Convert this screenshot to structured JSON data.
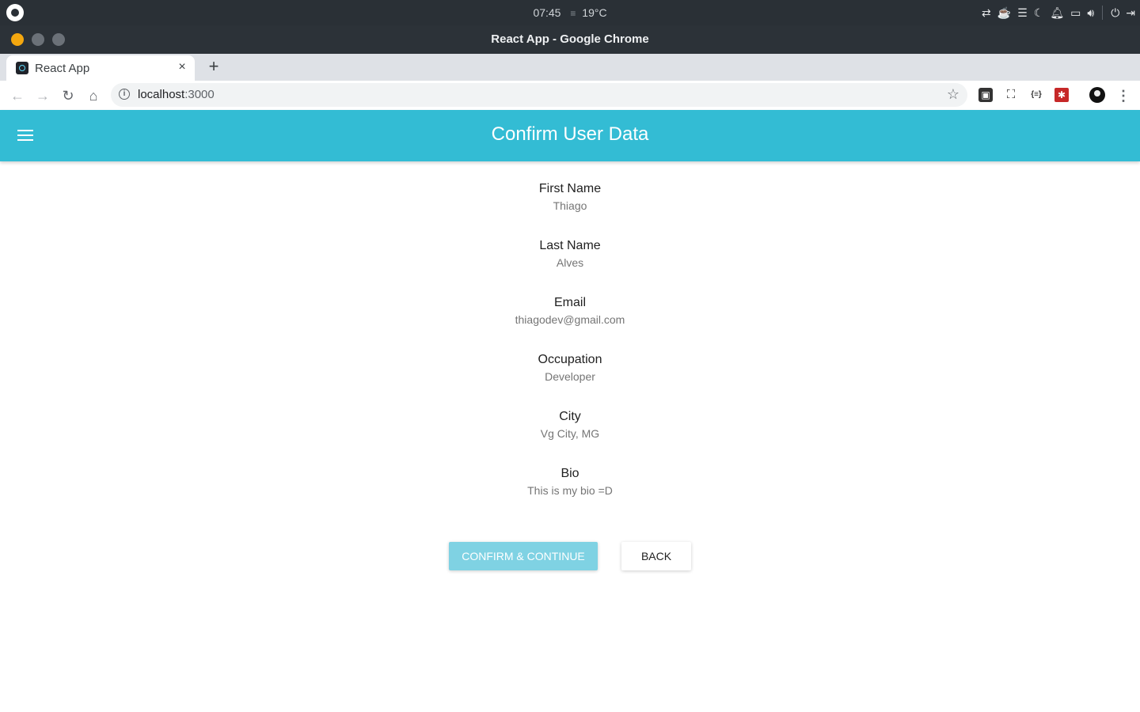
{
  "system": {
    "time": "07:45",
    "temperature": "19°C",
    "weather_icon": "fog-icon"
  },
  "window": {
    "title": "React App - Google Chrome"
  },
  "browser": {
    "tab_title": "React App",
    "tab_close": "×",
    "new_tab": "+",
    "url_host": "localhost",
    "url_port": ":3000"
  },
  "app": {
    "title": "Confirm User Data",
    "fields": [
      {
        "label": "First Name",
        "value": "Thiago"
      },
      {
        "label": "Last Name",
        "value": "Alves"
      },
      {
        "label": "Email",
        "value": "thiagodev@gmail.com"
      },
      {
        "label": "Occupation",
        "value": "Developer"
      },
      {
        "label": "City",
        "value": "Vg City, MG"
      },
      {
        "label": "Bio",
        "value": "This is my bio =D"
      }
    ],
    "confirm_label": "CONFIRM & CONTINUE",
    "back_label": "BACK"
  },
  "colors": {
    "appbar": "#33bcd4",
    "confirm_button": "#7fd2e3",
    "close_window": "#f4a70f"
  }
}
